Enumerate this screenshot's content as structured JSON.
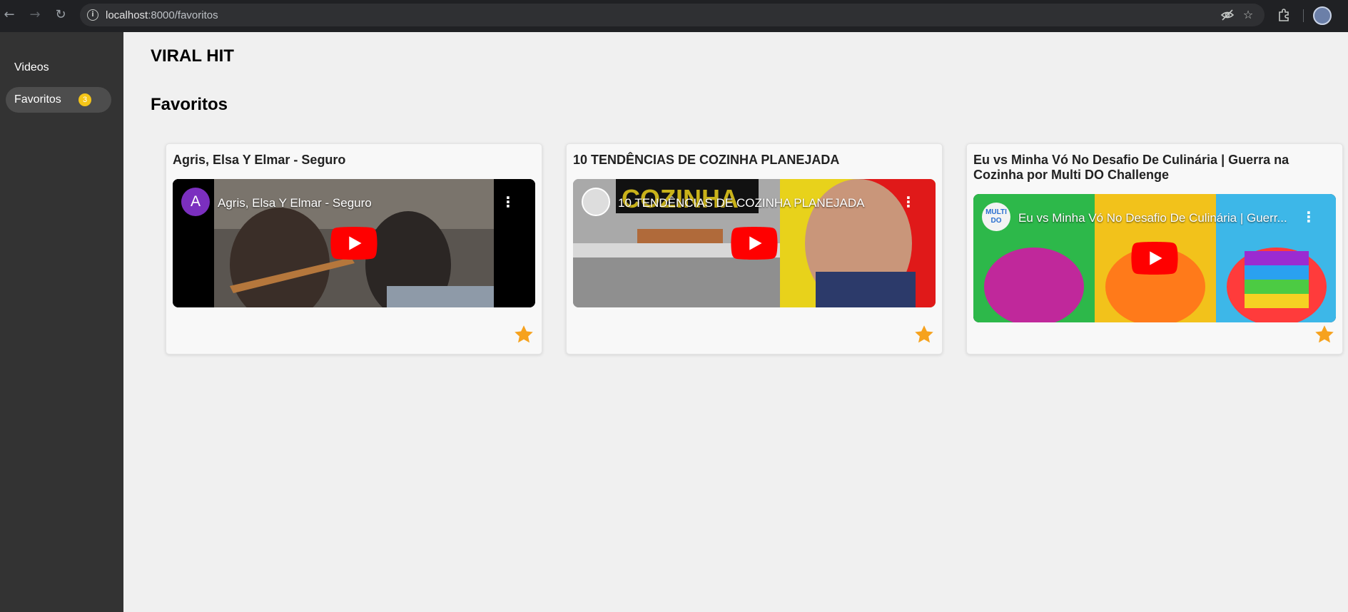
{
  "browser": {
    "url_host": "localhost",
    "url_path": ":8000/favoritos",
    "back_icon": "arrow-left-icon",
    "forward_icon": "arrow-right-icon",
    "reload_icon": "reload-icon"
  },
  "sidebar": {
    "items": [
      {
        "label": "Videos"
      },
      {
        "label": "Favoritos",
        "badge": "3",
        "active": true
      }
    ]
  },
  "header": {
    "app_title": "VIRAL HIT"
  },
  "main": {
    "page_title": "Favoritos",
    "cards": [
      {
        "title": "Agris, Elsa Y Elmar - Seguro",
        "video_title": "Agris, Elsa Y Elmar - Seguro",
        "channel_initial": "A",
        "favorited": true
      },
      {
        "title": "10 TENDÊNCIAS DE COZINHA PLANEJADA",
        "video_title": "10 TENDÊNCIAS DE COZINHA PLANEJADA",
        "thumb_text": "COZINHA",
        "favorited": true
      },
      {
        "title": "Eu vs Minha Vó No Desafio De Culinária | Guerra na Cozinha por Multi DO Challenge",
        "video_title": "Eu vs Minha Vó No Desafio De Culinária | Guerr...",
        "channel_logo_text": "MULTI DO",
        "favorited": true
      }
    ]
  },
  "colors": {
    "sidebar_bg": "#333333",
    "badge": "#f5c518",
    "star": "#f6a21e",
    "youtube_red": "#ff0000"
  }
}
